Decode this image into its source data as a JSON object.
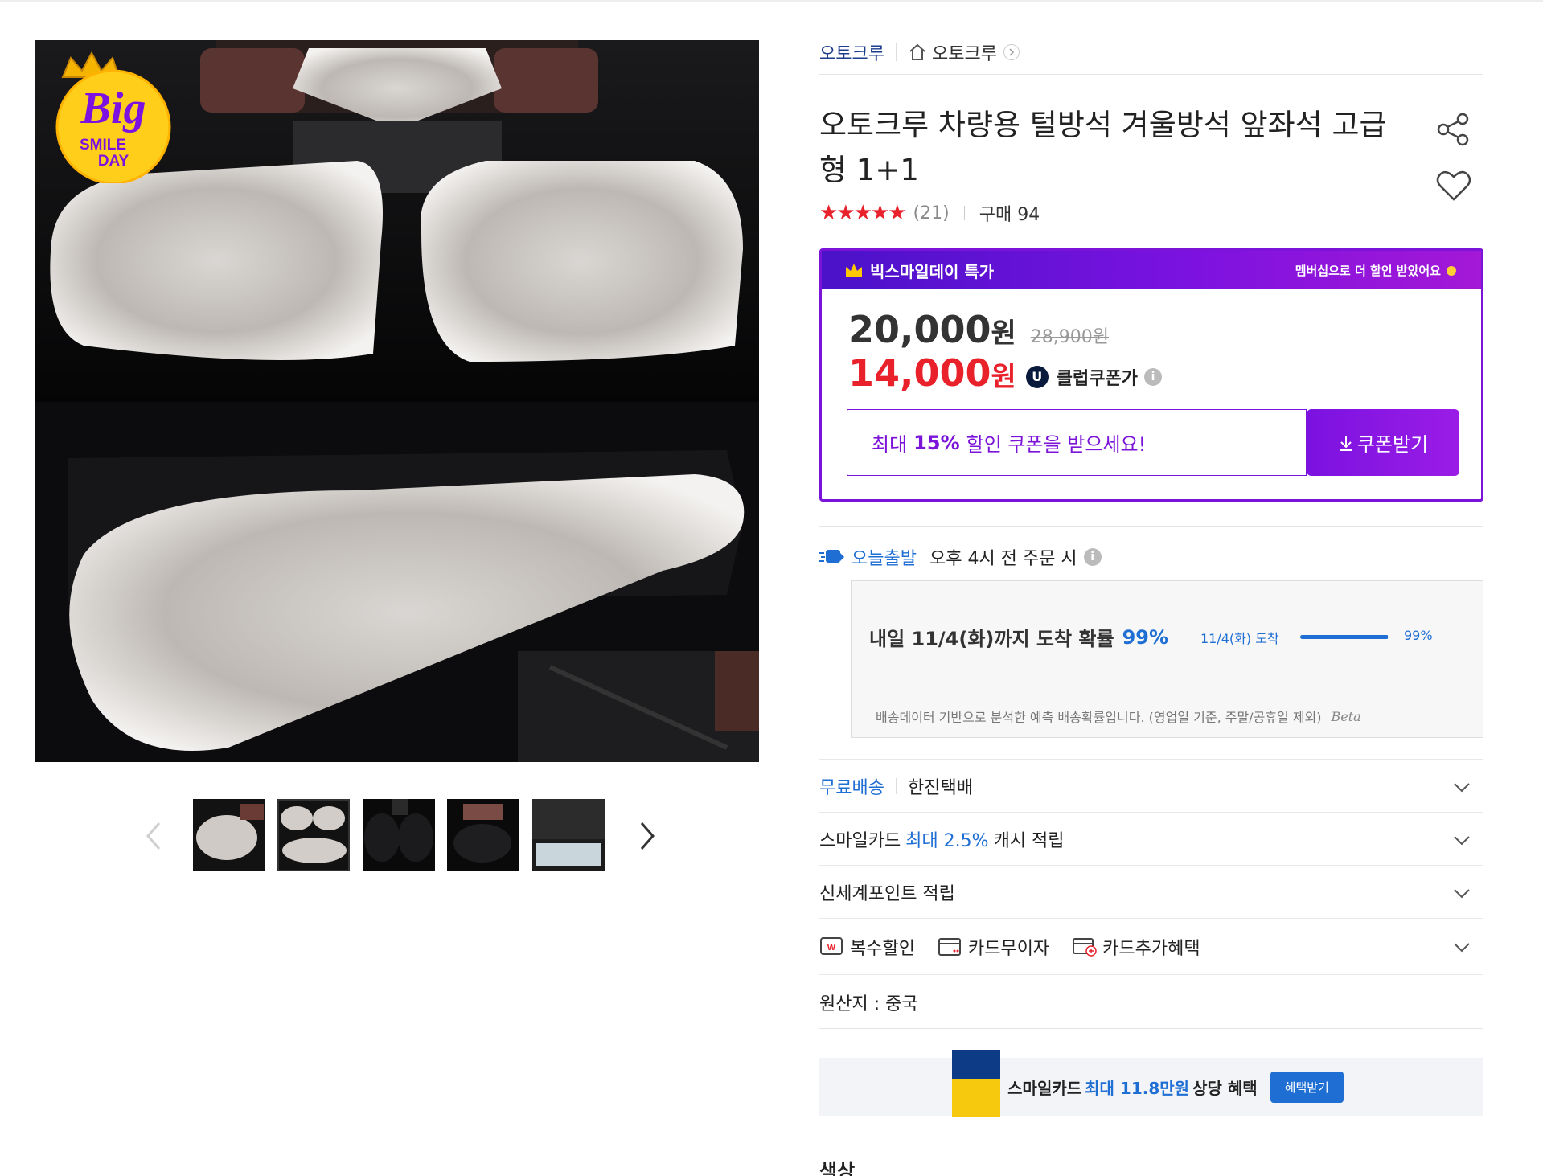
{
  "gallery": {
    "badge": {
      "line1": "Big",
      "line2": "SMILE",
      "line3": "DAY"
    },
    "thumbnails": [
      "thumb-1",
      "thumb-2",
      "thumb-3",
      "thumb-4",
      "thumb-5"
    ],
    "selected_thumbnail": 2
  },
  "brand": {
    "name": "오토크루",
    "store": "오토크루"
  },
  "product": {
    "title": "오토크루 차량용 털방석 겨울방석 앞좌석 고급형 1+1",
    "stars": "★★★★★",
    "review_count": "(21)",
    "purchases": "구매 94"
  },
  "deal": {
    "label": "빅스마일데이 특가",
    "membership_msg": "멤버십으로 더 할인 받았어요",
    "price": "20,000",
    "price_unit": "원",
    "original_price": "28,900원",
    "club_price": "14,000",
    "club_label": "클럽쿠폰가",
    "u_badge": "U",
    "coupon_prefix": "최대",
    "coupon_pct": "15%",
    "coupon_suffix": "할인 쿠폰을 받으세요!",
    "coupon_button": "쿠폰받기"
  },
  "shipping": {
    "label": "오늘출발",
    "condition": "오후 4시 전 주문 시",
    "prediction_main": "내일 11/4(화)까지 도착 확률",
    "prediction_pct": "99%",
    "bar_date": "11/4(화) 도착",
    "bar_pct": "99%",
    "bar_fraction": 0.99,
    "footnote": "배송데이터 기반으로 분석한 예측 배송확률입니다. (영업일 기준, 주말/공휴일 제외)",
    "beta": "Beta"
  },
  "info": {
    "free_ship": "무료배송",
    "carrier": "한진택배",
    "smilecard_prefix": "스마일카드",
    "smilecard_accent": "최대 2.5%",
    "smilecard_suffix": "캐시 적립",
    "shinsegae": "신세계포인트 적립",
    "benefit1": "복수할인",
    "benefit2": "카드무이자",
    "benefit3": "카드추가혜택",
    "origin": "원산지 : 중국"
  },
  "card_banner": {
    "prefix": "스마일카드",
    "accent": "최대 11.8만원",
    "suffix": "상당 혜택",
    "button": "혜택받기"
  },
  "options": {
    "color_title": "색상"
  },
  "colors": {
    "purple": "#7b13d9",
    "red": "#e8212b",
    "blue": "#1e6ed3",
    "navy": "#1e3c8c"
  }
}
